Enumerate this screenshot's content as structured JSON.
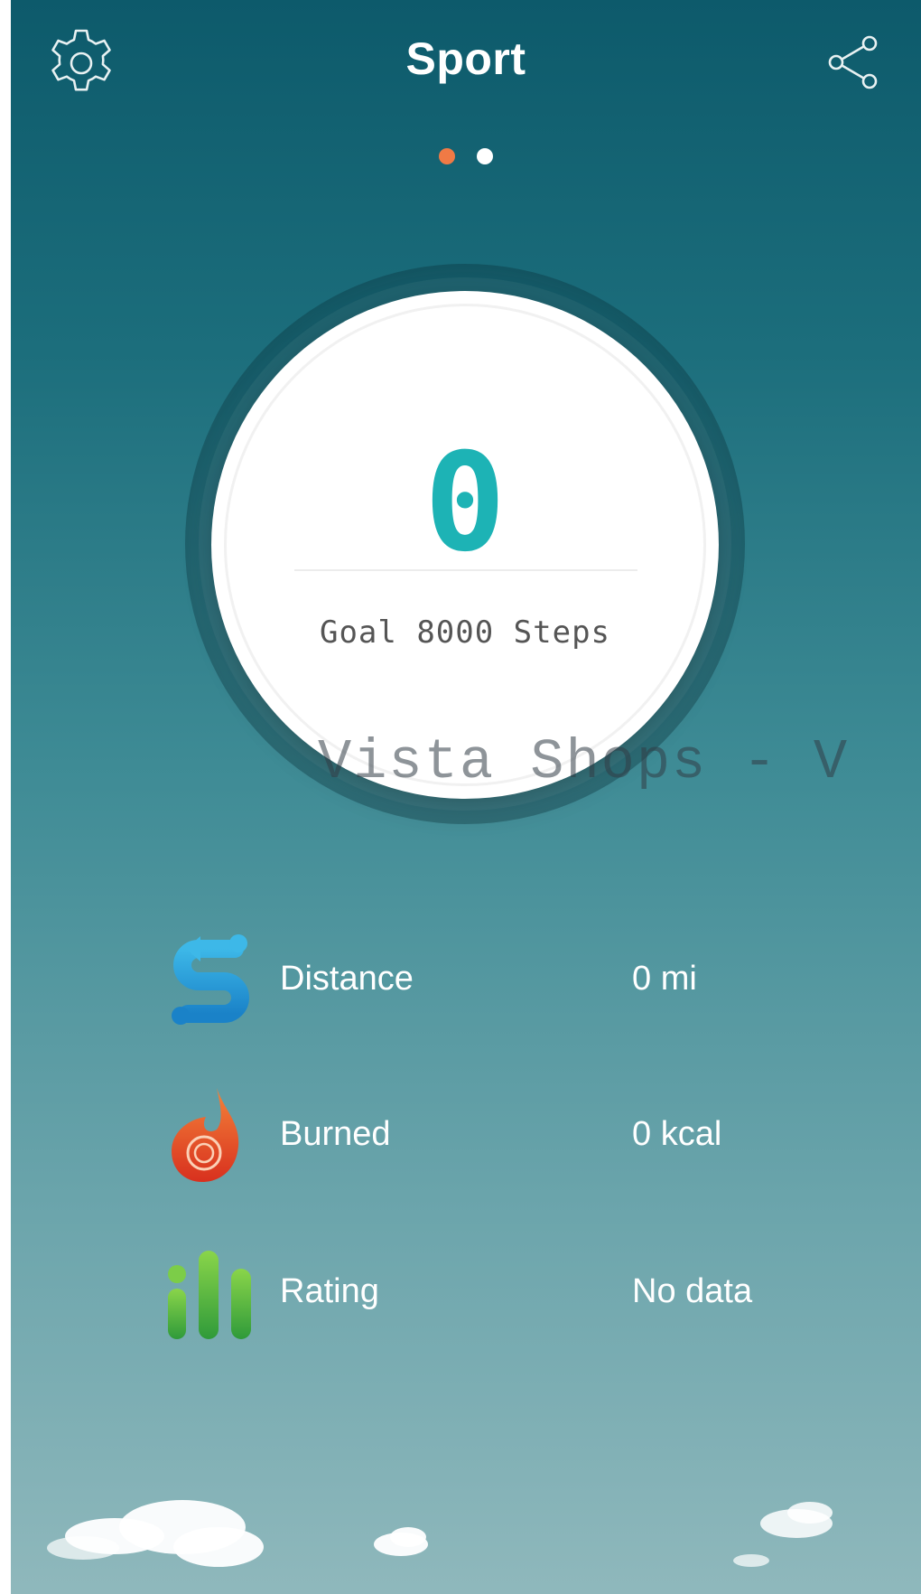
{
  "header": {
    "title": "Sport",
    "settings_icon": "gear-icon",
    "share_icon": "share-icon"
  },
  "pager": {
    "active_color": "#f07a45",
    "inactive_color": "#ffffff",
    "pages": 2,
    "active_index": 0
  },
  "progress": {
    "steps": "0",
    "goal_label": "Goal 8000 Steps",
    "steps_color": "#1db3b5"
  },
  "watermark": "Vista Shops - V",
  "stats": [
    {
      "icon": "distance-icon",
      "label": "Distance",
      "value": "0 mi"
    },
    {
      "icon": "flame-icon",
      "label": "Burned",
      "value": "0 kcal"
    },
    {
      "icon": "bar-rating-icon",
      "label": "Rating",
      "value": "No data"
    }
  ]
}
